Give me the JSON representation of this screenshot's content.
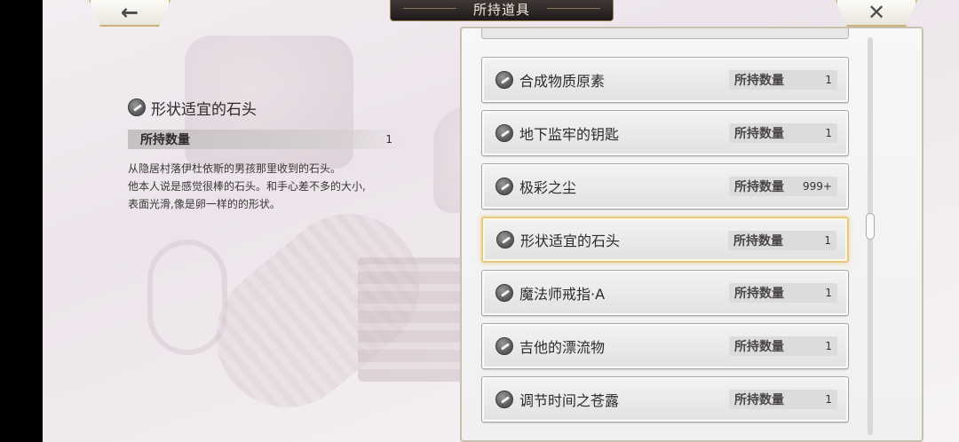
{
  "header": {
    "title": "所持道具",
    "back_icon": "←",
    "close_icon": "✕"
  },
  "detail": {
    "item_name": "形状适宜的石头",
    "qty_label": "所持数量",
    "qty_value": "1",
    "description": [
      "从隐居村落伊杜依斯的男孩那里收到的石头。",
      "他本人说是感觉很棒的石头。和手心差不多的大小,",
      "表面光滑,像是卵一样的的形状。"
    ]
  },
  "list": {
    "qty_label": "所持数量",
    "items": [
      {
        "name": "合成物质原素",
        "qty": "1",
        "selected": false
      },
      {
        "name": "地下监牢的钥匙",
        "qty": "1",
        "selected": false
      },
      {
        "name": "极彩之尘",
        "qty": "999+",
        "selected": false
      },
      {
        "name": "形状适宜的石头",
        "qty": "1",
        "selected": true
      },
      {
        "name": "魔法师戒指·A",
        "qty": "1",
        "selected": false
      },
      {
        "name": "吉他的漂流物",
        "qty": "1",
        "selected": false
      },
      {
        "name": "调节时间之苍露",
        "qty": "1",
        "selected": false
      }
    ]
  },
  "colors": {
    "selected_border": "#e5c982",
    "title_bar": "#2a2424",
    "button_border": "#c9b27b"
  }
}
